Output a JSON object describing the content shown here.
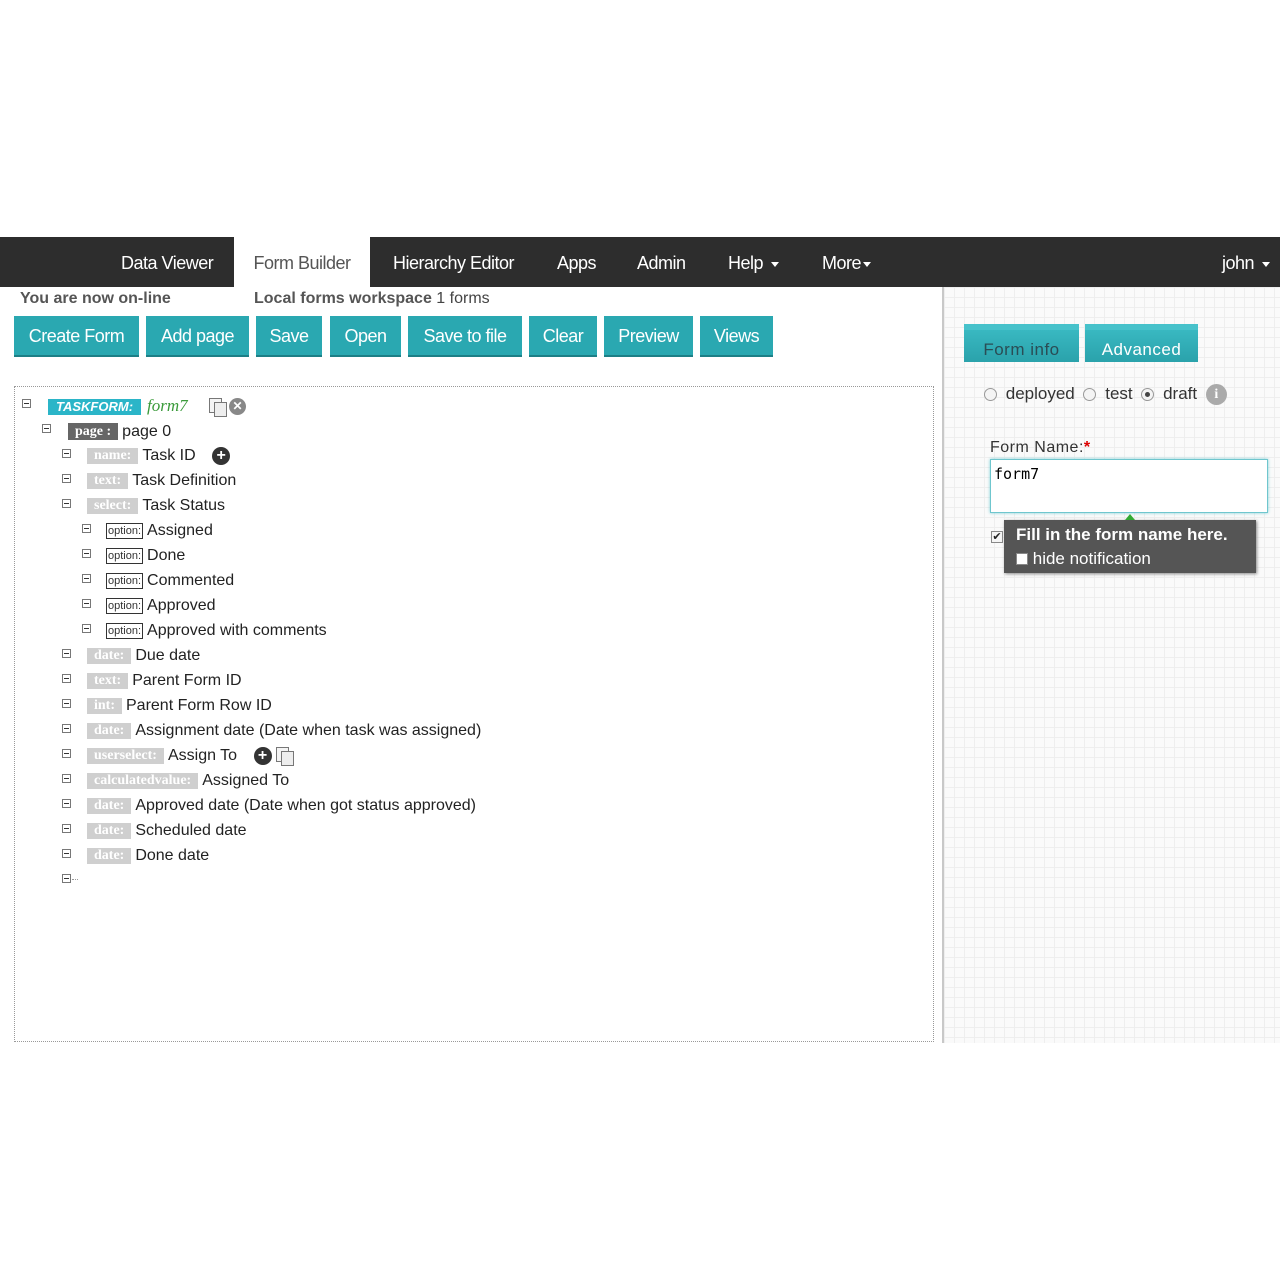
{
  "nav": {
    "items": [
      "Data Viewer",
      "Form Builder",
      "Hierarchy Editor",
      "Apps",
      "Admin",
      "Help",
      "More",
      "john"
    ],
    "active": "Form Builder"
  },
  "status": {
    "online": "You are now on-line",
    "workspace_label": "Local forms workspace",
    "workspace_count": "1 forms"
  },
  "toolbar": [
    "Create Form",
    "Add page",
    "Save",
    "Open",
    "Save to file",
    "Clear",
    "Preview",
    "Views"
  ],
  "tree": {
    "root_type": "TASKFORM:",
    "root_name": "form7",
    "page_type": "page :",
    "page_name": "page 0",
    "fields": [
      {
        "type": "name:",
        "label": "Task ID"
      },
      {
        "type": "text:",
        "label": "Task Definition"
      },
      {
        "type": "select:",
        "label": "Task Status"
      },
      {
        "type": "option:",
        "label": "Assigned"
      },
      {
        "type": "option:",
        "label": "Done"
      },
      {
        "type": "option:",
        "label": "Commented"
      },
      {
        "type": "option:",
        "label": "Approved"
      },
      {
        "type": "option:",
        "label": "Approved with comments"
      },
      {
        "type": "date:",
        "label": "Due date"
      },
      {
        "type": "text:",
        "label": "Parent Form ID"
      },
      {
        "type": "int:",
        "label": "Parent Form Row ID"
      },
      {
        "type": "date:",
        "label": "Assignment date (Date when task was assigned)"
      },
      {
        "type": "userselect:",
        "label": "Assign To"
      },
      {
        "type": "calculatedvalue:",
        "label": "Assigned To"
      },
      {
        "type": "date:",
        "label": "Approved date (Date when got status approved)"
      },
      {
        "type": "date:",
        "label": "Scheduled date"
      },
      {
        "type": "date:",
        "label": "Done date"
      }
    ]
  },
  "right": {
    "tabs": [
      "Form info",
      "Advanced"
    ],
    "status_options": [
      "deployed",
      "test",
      "draft"
    ],
    "status_selected": "draft",
    "form_name_label": "Form Name:",
    "required_mark": "*",
    "form_name_value": "form7",
    "tooltip_title": "Fill in the form name here.",
    "tooltip_hide": "hide notification"
  },
  "colors": {
    "accent": "#2aa8b1",
    "navbar": "#2d2d2d",
    "taskform_badge": "#2bb5c8"
  }
}
